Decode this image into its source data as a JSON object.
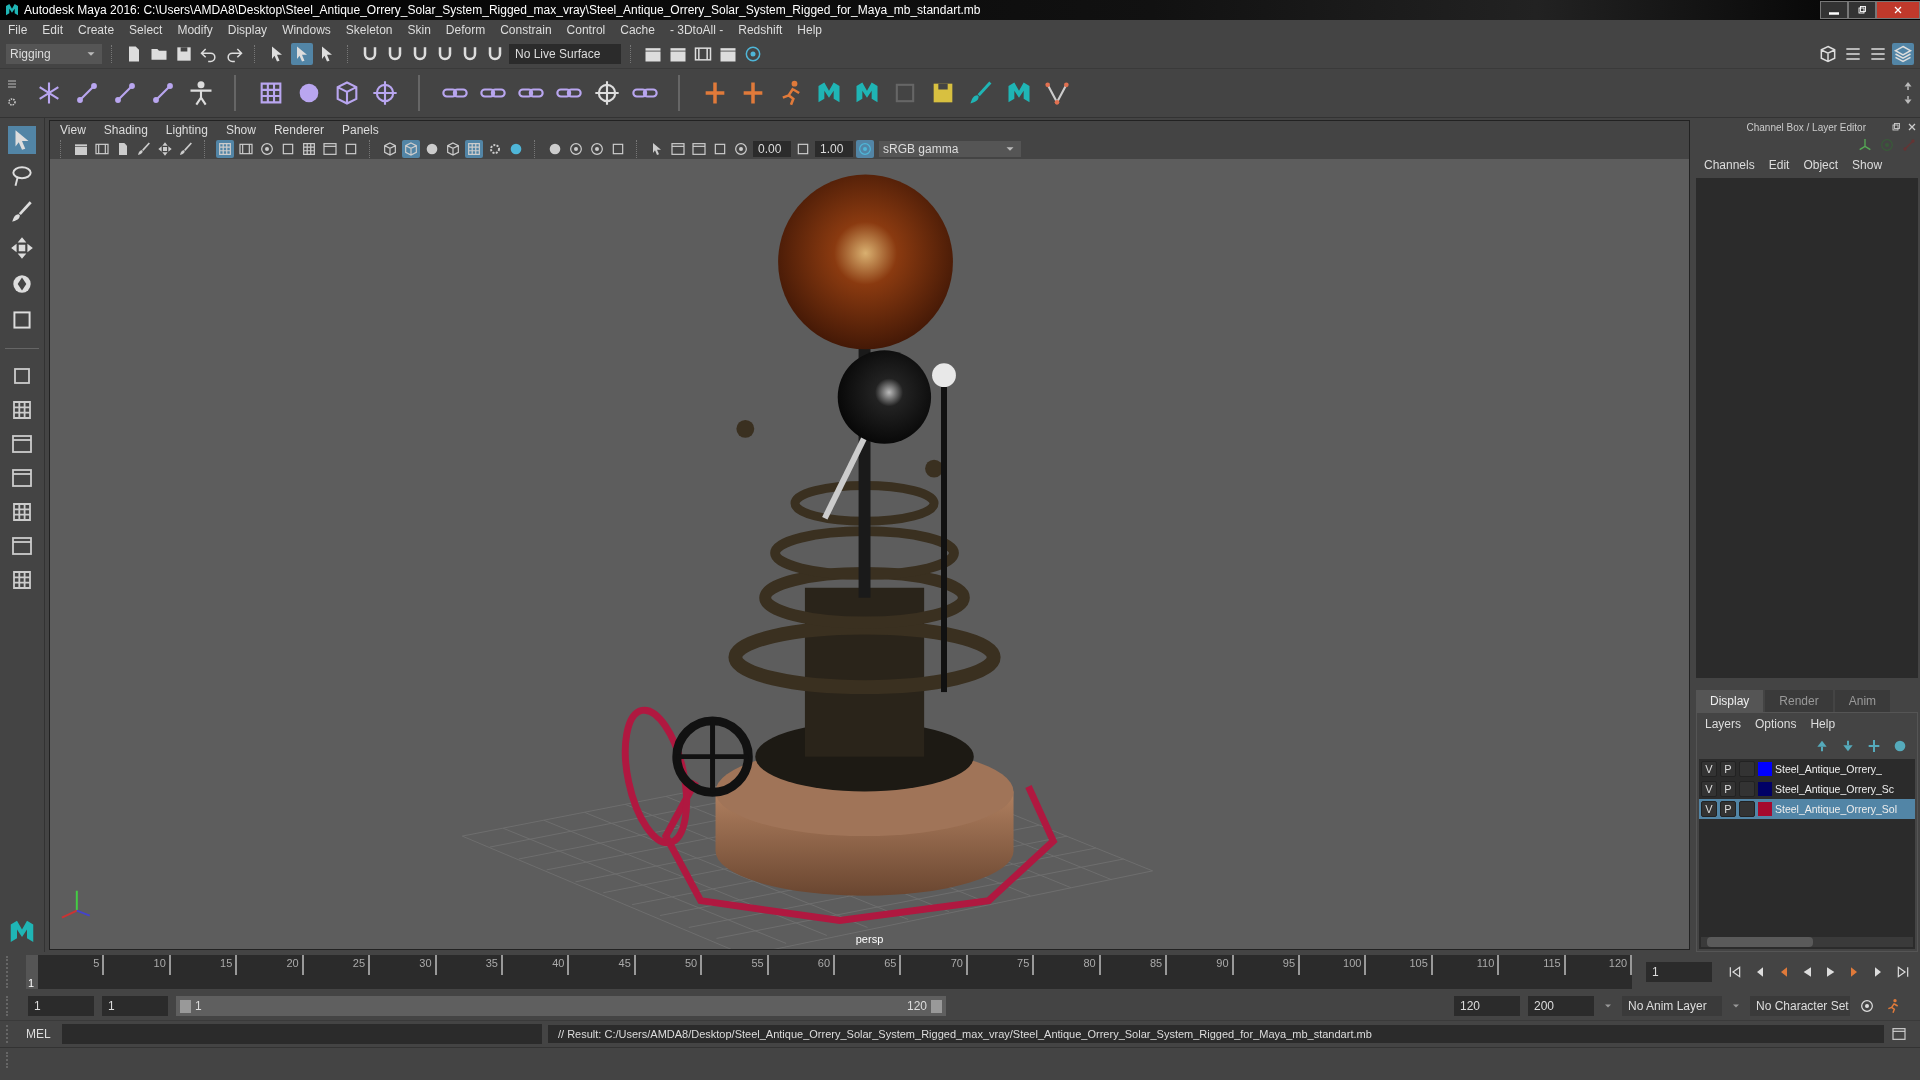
{
  "window": {
    "title": "Autodesk Maya 2016: C:\\Users\\AMDA8\\Desktop\\Steel_Antique_Orrery_Solar_System_Rigged_max_vray\\Steel_Antique_Orrery_Solar_System_Rigged_for_Maya_mb_standart.mb"
  },
  "menu_bar": [
    "File",
    "Edit",
    "Create",
    "Select",
    "Modify",
    "Display",
    "Windows",
    "Skeleton",
    "Skin",
    "Deform",
    "Constrain",
    "Control",
    "Cache",
    "- 3DtoAll -",
    "Redshift",
    "Help"
  ],
  "status_line": {
    "mode": "Rigging",
    "live_surface": "No Live Surface"
  },
  "viewport": {
    "menu": [
      "View",
      "Shading",
      "Lighting",
      "Show",
      "Renderer",
      "Panels"
    ],
    "exposure": "0.00",
    "gamma": "1.00",
    "color_space": "sRGB gamma",
    "camera_label": "persp"
  },
  "channel_box": {
    "title": "Channel Box / Layer Editor",
    "menu": [
      "Channels",
      "Edit",
      "Object",
      "Show"
    ]
  },
  "layer_editor": {
    "tabs": [
      {
        "label": "Display",
        "selected": true
      },
      {
        "label": "Render",
        "selected": false
      },
      {
        "label": "Anim",
        "selected": false
      }
    ],
    "menu": [
      "Layers",
      "Options",
      "Help"
    ],
    "layers": [
      {
        "visible": "V",
        "playback": "P",
        "color": "#0000ff",
        "name": "Steel_Antique_Orrery_",
        "selected": false
      },
      {
        "visible": "V",
        "playback": "P",
        "color": "#000066",
        "name": "Steel_Antique_Orrery_Sc",
        "selected": false
      },
      {
        "visible": "V",
        "playback": "P",
        "color": "#a50a2d",
        "name": "Steel_Antique_Orrery_Sol",
        "selected": true
      }
    ]
  },
  "timeline": {
    "current_frame": "1",
    "level": 0,
    "ticks": [
      "5",
      "10",
      "15",
      "20",
      "25",
      "30",
      "35",
      "40",
      "45",
      "50",
      "55",
      "60",
      "65",
      "70",
      "75",
      "80",
      "85",
      "90",
      "95",
      "100",
      "105",
      "110",
      "115",
      "120"
    ],
    "frame_field": "1"
  },
  "range": {
    "level": 1,
    "start": "1",
    "inner_start": "1",
    "slider_start": "1",
    "slider_end": "120",
    "inner_end": "120",
    "end": "200",
    "anim_layer": "No Anim Layer",
    "character_set": "No Character Set"
  },
  "command_line": {
    "label": "MEL",
    "result": "// Result: C:/Users/AMDA8/Desktop/Steel_Antique_Orrery_Solar_System_Rigged_max_vray/Steel_Antique_Orrery_Solar_System_Rigged_for_Maya_mb_standart.mb"
  }
}
